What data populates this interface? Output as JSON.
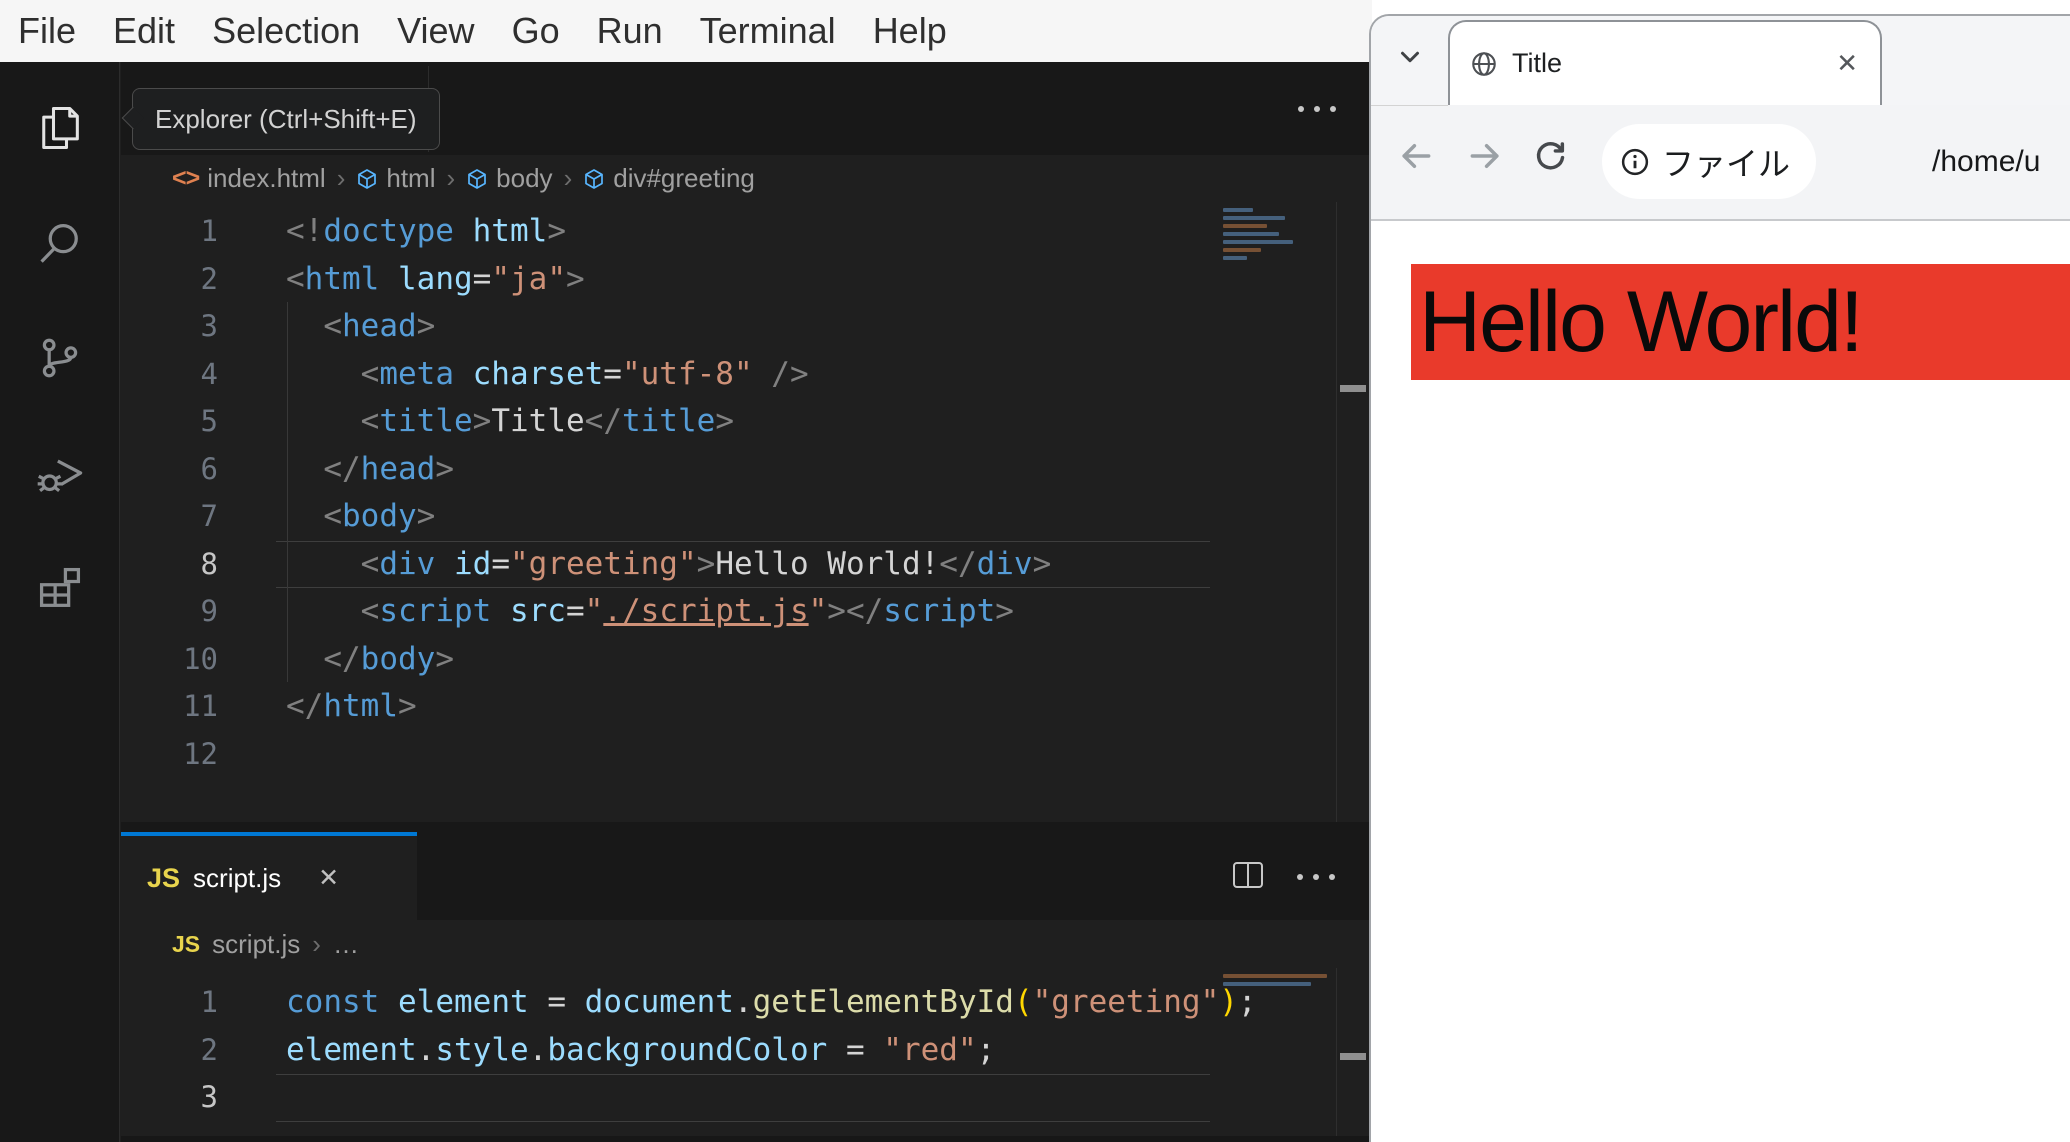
{
  "menu_bar": {
    "items": [
      "File",
      "Edit",
      "Selection",
      "View",
      "Go",
      "Run",
      "Terminal",
      "Help"
    ]
  },
  "activity_bar": {
    "tooltip": "Explorer (Ctrl+Shift+E)",
    "icons": [
      "explorer-icon",
      "search-icon",
      "source-control-icon",
      "run-debug-icon",
      "extensions-icon"
    ]
  },
  "icons": {
    "js_badge": "JS"
  },
  "editor_top": {
    "breadcrumbs": [
      {
        "icon": "code",
        "label": "index.html"
      },
      {
        "icon": "cube",
        "label": "html"
      },
      {
        "icon": "cube",
        "label": "body"
      },
      {
        "icon": "cube",
        "label": "div#greeting"
      }
    ],
    "active_line": 8,
    "lines": [
      {
        "n": 1,
        "tokens": [
          [
            "punct",
            "<!"
          ],
          [
            "tag",
            "doctype"
          ],
          [
            "attr",
            " html"
          ],
          [
            "punct",
            ">"
          ]
        ]
      },
      {
        "n": 2,
        "tokens": [
          [
            "punct",
            "<"
          ],
          [
            "tag",
            "html"
          ],
          [
            "attr",
            " lang"
          ],
          [
            "op",
            "="
          ],
          [
            "str",
            "\"ja\""
          ],
          [
            "punct",
            ">"
          ]
        ]
      },
      {
        "n": 3,
        "tokens": [
          [
            "plain",
            "  "
          ],
          [
            "punct",
            "<"
          ],
          [
            "tag",
            "head"
          ],
          [
            "punct",
            ">"
          ]
        ]
      },
      {
        "n": 4,
        "tokens": [
          [
            "plain",
            "    "
          ],
          [
            "punct",
            "<"
          ],
          [
            "tag",
            "meta"
          ],
          [
            "attr",
            " charset"
          ],
          [
            "op",
            "="
          ],
          [
            "str",
            "\"utf-8\""
          ],
          [
            "plain",
            " "
          ],
          [
            "punct",
            "/>"
          ]
        ]
      },
      {
        "n": 5,
        "tokens": [
          [
            "plain",
            "    "
          ],
          [
            "punct",
            "<"
          ],
          [
            "tag",
            "title"
          ],
          [
            "punct",
            ">"
          ],
          [
            "plain",
            "Title"
          ],
          [
            "punct",
            "</"
          ],
          [
            "tag",
            "title"
          ],
          [
            "punct",
            ">"
          ]
        ]
      },
      {
        "n": 6,
        "tokens": [
          [
            "plain",
            "  "
          ],
          [
            "punct",
            "</"
          ],
          [
            "tag",
            "head"
          ],
          [
            "punct",
            ">"
          ]
        ]
      },
      {
        "n": 7,
        "tokens": [
          [
            "plain",
            "  "
          ],
          [
            "punct",
            "<"
          ],
          [
            "tag",
            "body"
          ],
          [
            "punct",
            ">"
          ]
        ]
      },
      {
        "n": 8,
        "tokens": [
          [
            "plain",
            "    "
          ],
          [
            "punct",
            "<"
          ],
          [
            "tag",
            "div"
          ],
          [
            "attr",
            " id"
          ],
          [
            "op",
            "="
          ],
          [
            "str",
            "\"greeting\""
          ],
          [
            "punct",
            ">"
          ],
          [
            "plain",
            "Hello World!"
          ],
          [
            "punct",
            "</"
          ],
          [
            "tag",
            "div"
          ],
          [
            "punct",
            ">"
          ]
        ]
      },
      {
        "n": 9,
        "tokens": [
          [
            "plain",
            "    "
          ],
          [
            "punct",
            "<"
          ],
          [
            "tag",
            "script"
          ],
          [
            "attr",
            " src"
          ],
          [
            "op",
            "="
          ],
          [
            "str",
            "\""
          ],
          [
            "strU",
            "./script.js"
          ],
          [
            "str",
            "\""
          ],
          [
            "punct",
            ">"
          ],
          [
            "punct",
            "</"
          ],
          [
            "tag",
            "script"
          ],
          [
            "punct",
            ">"
          ]
        ]
      },
      {
        "n": 10,
        "tokens": [
          [
            "plain",
            "  "
          ],
          [
            "punct",
            "</"
          ],
          [
            "tag",
            "body"
          ],
          [
            "punct",
            ">"
          ]
        ]
      },
      {
        "n": 11,
        "tokens": [
          [
            "punct",
            "</"
          ],
          [
            "tag",
            "html"
          ],
          [
            "punct",
            ">"
          ]
        ]
      },
      {
        "n": 12,
        "tokens": []
      }
    ]
  },
  "panel_tab": {
    "label": "script.js"
  },
  "editor_bottom": {
    "breadcrumb": {
      "file": "script.js",
      "separator": "›",
      "more": "…"
    },
    "active_line": 3,
    "lines": [
      {
        "n": 1,
        "tokens": [
          [
            "kw",
            "const"
          ],
          [
            "plain",
            " "
          ],
          [
            "var",
            "element"
          ],
          [
            "op",
            " = "
          ],
          [
            "var",
            "document"
          ],
          [
            "plain",
            "."
          ],
          [
            "fn",
            "getElementById"
          ],
          [
            "paren",
            "("
          ],
          [
            "str",
            "\"greeting\""
          ],
          [
            "paren",
            ")"
          ],
          [
            "plain",
            ";"
          ]
        ]
      },
      {
        "n": 2,
        "tokens": [
          [
            "var",
            "element"
          ],
          [
            "plain",
            "."
          ],
          [
            "attr",
            "style"
          ],
          [
            "plain",
            "."
          ],
          [
            "attr",
            "backgroundColor"
          ],
          [
            "op",
            " = "
          ],
          [
            "str",
            "\"red\""
          ],
          [
            "plain",
            ";"
          ]
        ]
      },
      {
        "n": 3,
        "tokens": []
      }
    ]
  },
  "browser": {
    "tab": {
      "title": "Title"
    },
    "toolbar": {
      "scheme_chip": "ファイル",
      "url": "/home/u"
    },
    "page": {
      "text": "Hello World!",
      "background": "#e93a2b"
    }
  },
  "colors": {
    "accent_tab_blue": "#0078d4",
    "editor_bg": "#1f1f1f",
    "activity_bar_bg": "#181818",
    "tag_blue": "#569cd6",
    "attr_blue": "#9cdcfe",
    "string_orange": "#ce9178",
    "function_yellow": "#dcdcaa",
    "page_red": "#e93a2b"
  }
}
